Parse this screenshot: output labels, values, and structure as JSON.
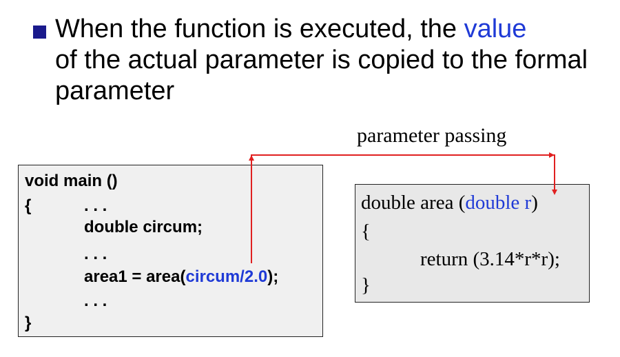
{
  "heading": {
    "part1": "When the function is executed, the ",
    "highlight": "value",
    "part2": "of the actual parameter is copied to the formal parameter"
  },
  "arrow_label": "parameter passing",
  "main_code": {
    "line1": "void main ()",
    "brace_open": "{",
    "dots1": ". . .",
    "line2": "double circum;",
    "dots2": ". . .",
    "line3_pre": "area1 = area(",
    "line3_arg": "circum/2.0",
    "line3_post": ");",
    "dots3": ". . .",
    "brace_close": "}"
  },
  "area_code": {
    "sig_pre": "double area (",
    "sig_param_type": "double ",
    "sig_param": "r",
    "sig_post": ")",
    "brace_open": "{",
    "body": "return (3.14*r*r);",
    "brace_close": "}"
  },
  "colors": {
    "highlight": "#1f3ad6",
    "arrow": "#e02020",
    "bullet": "#1a1a8c"
  }
}
